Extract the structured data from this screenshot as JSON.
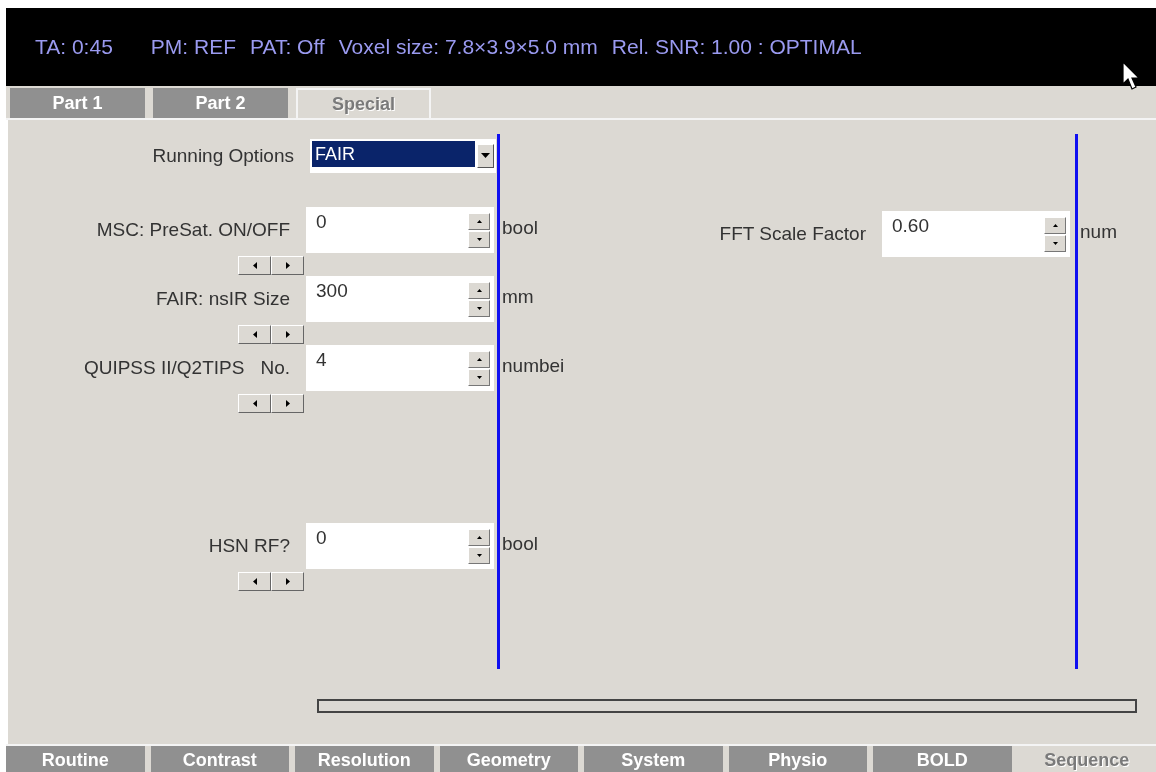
{
  "header": {
    "items": [
      "TA: 0:45",
      "PM: REF",
      "PAT: Off",
      "Voxel size: 7.8×3.9×5.0 mm",
      "Rel. SNR: 1.00 : OPTIMAL"
    ]
  },
  "top_tabs": [
    {
      "label": "Part 1",
      "selected": false
    },
    {
      "label": "Part 2",
      "selected": false
    },
    {
      "label": "Special",
      "selected": true
    }
  ],
  "running_options": {
    "label": "Running Options",
    "value": "FAIR"
  },
  "left_params": [
    {
      "label": "MSC: PreSat. ON/OFF",
      "value": "0",
      "unit": "bool"
    },
    {
      "label": "FAIR: nsIR Size",
      "value": "300",
      "unit": "mm"
    },
    {
      "label": "QUIPSS II/Q2TIPS",
      "label_suffix": "No.",
      "value": "4",
      "unit": "numbei"
    },
    {
      "label": "HSN RF?",
      "value": "0",
      "unit": "bool"
    }
  ],
  "right_params": [
    {
      "label": "FFT Scale Factor",
      "value": "0.60",
      "unit": "num"
    }
  ],
  "bottom_tabs": [
    {
      "label": "Routine",
      "selected": false
    },
    {
      "label": "Contrast",
      "selected": false
    },
    {
      "label": "Resolution",
      "selected": false
    },
    {
      "label": "Geometry",
      "selected": false
    },
    {
      "label": "System",
      "selected": false
    },
    {
      "label": "Physio",
      "selected": false
    },
    {
      "label": "BOLD",
      "selected": false
    },
    {
      "label": "Sequence",
      "selected": true
    }
  ]
}
